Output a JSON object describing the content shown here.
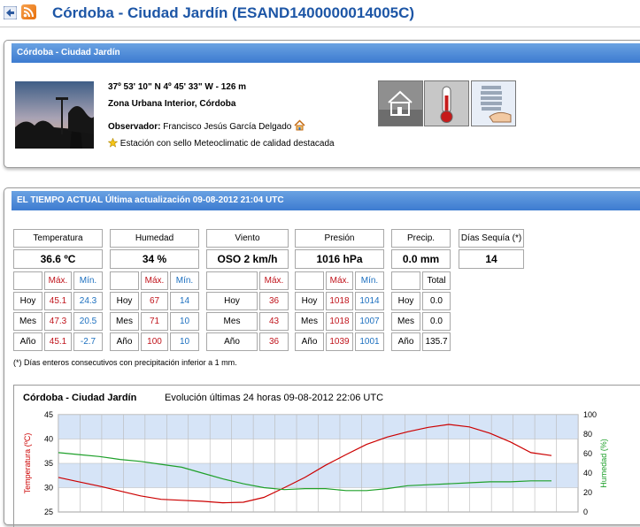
{
  "header": {
    "title": "Córdoba - Ciudad Jardín (ESAND1400000014005C)"
  },
  "station": {
    "panel_title": "Córdoba - Ciudad Jardín",
    "coords": "37º 53' 10\" N   4º 45' 33\" W  -  126 m",
    "zone": "Zona Urbana Interior, Córdoba",
    "observer_label": "Observador:",
    "observer_name": "Francisco Jesús García Delgado",
    "seal_text": "Estación con sello Meteoclimatic de calidad destacada"
  },
  "current": {
    "panel_title": "EL TIEMPO ACTUAL Última actualización 09-08-2012 21:04 UTC",
    "footnote": "(*) Días enteros consecutivos con precipitación inferior a 1 mm.",
    "temperatura": {
      "label": "Temperatura",
      "value": "36.6 ºC",
      "max_label": "Máx.",
      "min_label": "Mín.",
      "rows": [
        {
          "period": "Hoy",
          "max": "45.1",
          "min": "24.3"
        },
        {
          "period": "Mes",
          "max": "47.3",
          "min": "20.5"
        },
        {
          "period": "Año",
          "max": "45.1",
          "min": "-2.7"
        }
      ]
    },
    "humedad": {
      "label": "Humedad",
      "value": "34 %",
      "max_label": "Máx.",
      "min_label": "Mín.",
      "rows": [
        {
          "period": "Hoy",
          "max": "67",
          "min": "14"
        },
        {
          "period": "Mes",
          "max": "71",
          "min": "10"
        },
        {
          "period": "Año",
          "max": "100",
          "min": "10"
        }
      ]
    },
    "viento": {
      "label": "Viento",
      "value": "OSO  2 km/h",
      "max_label": "Máx.",
      "rows": [
        {
          "period": "Hoy",
          "max": "36"
        },
        {
          "period": "Mes",
          "max": "43"
        },
        {
          "period": "Año",
          "max": "36"
        }
      ]
    },
    "presion": {
      "label": "Presión",
      "value": "1016 hPa",
      "max_label": "Máx.",
      "min_label": "Mín.",
      "rows": [
        {
          "period": "Hoy",
          "max": "1018",
          "min": "1014"
        },
        {
          "period": "Mes",
          "max": "1018",
          "min": "1007"
        },
        {
          "period": "Año",
          "max": "1039",
          "min": "1001"
        }
      ]
    },
    "precip": {
      "label": "Precip.",
      "value": "0.0 mm",
      "total_label": "Total",
      "rows": [
        {
          "period": "Hoy",
          "total": "0.0"
        },
        {
          "period": "Mes",
          "total": "0.0"
        },
        {
          "period": "Año",
          "total": "135.7"
        }
      ]
    },
    "sequia": {
      "label": "Días Sequía (*)",
      "value": "14"
    }
  },
  "chart_data": {
    "type": "line",
    "title": "Córdoba - Ciudad Jardín",
    "subtitle": "Evolución últimas 24 horas 09-08-2012 22:06 UTC",
    "ylabel": "Temperatura (ºC)",
    "y2label": "Humedad (%)",
    "ylim": [
      25,
      45
    ],
    "y2lim": [
      0,
      100
    ],
    "yticks": [
      "45",
      "40",
      "35",
      "30",
      "25"
    ],
    "y2ticks": [
      "100",
      "80",
      "60",
      "40",
      "20",
      "0"
    ],
    "x": [
      0,
      1,
      2,
      3,
      4,
      5,
      6,
      7,
      8,
      9,
      10,
      11,
      12,
      13,
      14,
      15,
      16,
      17,
      18,
      19,
      20,
      21,
      22,
      23,
      24
    ],
    "series": [
      {
        "name": "Temperatura",
        "axis": "left",
        "color": "#cc0000",
        "values": [
          32.1,
          31.2,
          30.3,
          29.3,
          28.3,
          27.6,
          27.4,
          27.2,
          26.9,
          27.0,
          28.0,
          30.0,
          32.1,
          34.6,
          36.8,
          38.9,
          40.4,
          41.5,
          42.4,
          43.0,
          42.5,
          41.2,
          39.4,
          37.2,
          36.6
        ]
      },
      {
        "name": "Humedad",
        "axis": "right",
        "color": "#1ea02a",
        "values": [
          61,
          59,
          57,
          54,
          52,
          49,
          46,
          40,
          34,
          29,
          25,
          23,
          24,
          24,
          22,
          22,
          24,
          27,
          28,
          29,
          30,
          31,
          31,
          32,
          32
        ]
      }
    ],
    "bands": [
      [
        40,
        45
      ],
      [
        30,
        35
      ]
    ],
    "colors": {
      "band": "#d6e4f7",
      "grid": "#b8b8b8",
      "temp": "#cc0000",
      "hum": "#1ea02a"
    }
  }
}
